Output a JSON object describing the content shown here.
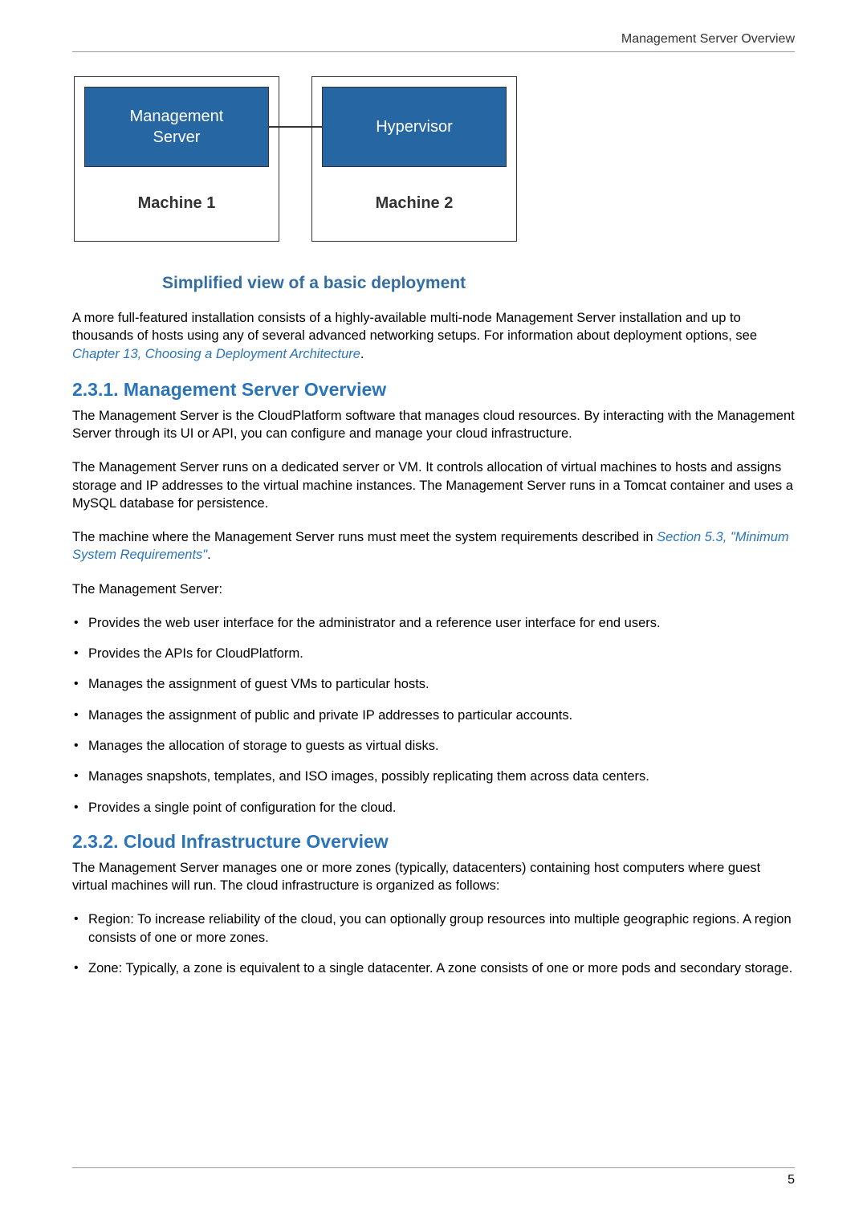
{
  "header": {
    "running_title": "Management Server Overview"
  },
  "diagram": {
    "box1": {
      "top_label": "Management\nServer",
      "bottom_label": "Machine 1"
    },
    "box2": {
      "top_label": "Hypervisor",
      "bottom_label": "Machine 2"
    },
    "caption": "Simplified view of a basic deployment"
  },
  "intro_para": {
    "text_before": "A more full-featured installation consists of a highly-available multi-node Management Server installation and up to thousands of hosts using any of several advanced networking setups. For information about deployment options, see ",
    "link": "Chapter 13, Choosing a Deployment Architecture",
    "text_after": "."
  },
  "section_231": {
    "title": "2.3.1. Management Server Overview",
    "p1": "The Management Server is the CloudPlatform software that manages cloud resources. By interacting with the Management Server through its UI or API, you can configure and manage your cloud infrastructure.",
    "p2": "The Management Server runs on a dedicated server or VM. It controls allocation of virtual machines to hosts and assigns storage and IP addresses to the virtual machine instances. The Management Server runs in a Tomcat container and uses a MySQL database for persistence.",
    "p3_before": "The machine where the Management Server runs must meet the system requirements described in ",
    "p3_link": "Section 5.3, \"Minimum System Requirements\"",
    "p3_after": ".",
    "p4": "The Management Server:",
    "bullets": [
      "Provides the web user interface for the administrator and a reference user interface for end users.",
      "Provides the APIs for CloudPlatform.",
      "Manages the assignment of guest VMs to particular hosts.",
      "Manages the assignment of public and private IP addresses to particular accounts.",
      "Manages the allocation of storage to guests as virtual disks.",
      "Manages snapshots, templates, and ISO images, possibly replicating them across data centers.",
      "Provides a single point of configuration for the cloud."
    ]
  },
  "section_232": {
    "title": "2.3.2. Cloud Infrastructure Overview",
    "p1": "The Management Server manages one or more zones (typically, datacenters) containing host computers where guest virtual machines will run. The cloud infrastructure is organized as follows:",
    "bullets": [
      "Region: To increase reliability of the cloud, you can optionally group resources into multiple geographic regions. A region consists of one or more zones.",
      "Zone: Typically, a zone is equivalent to a single datacenter. A zone consists of one or more pods and secondary storage."
    ]
  },
  "footer": {
    "page_number": "5"
  }
}
